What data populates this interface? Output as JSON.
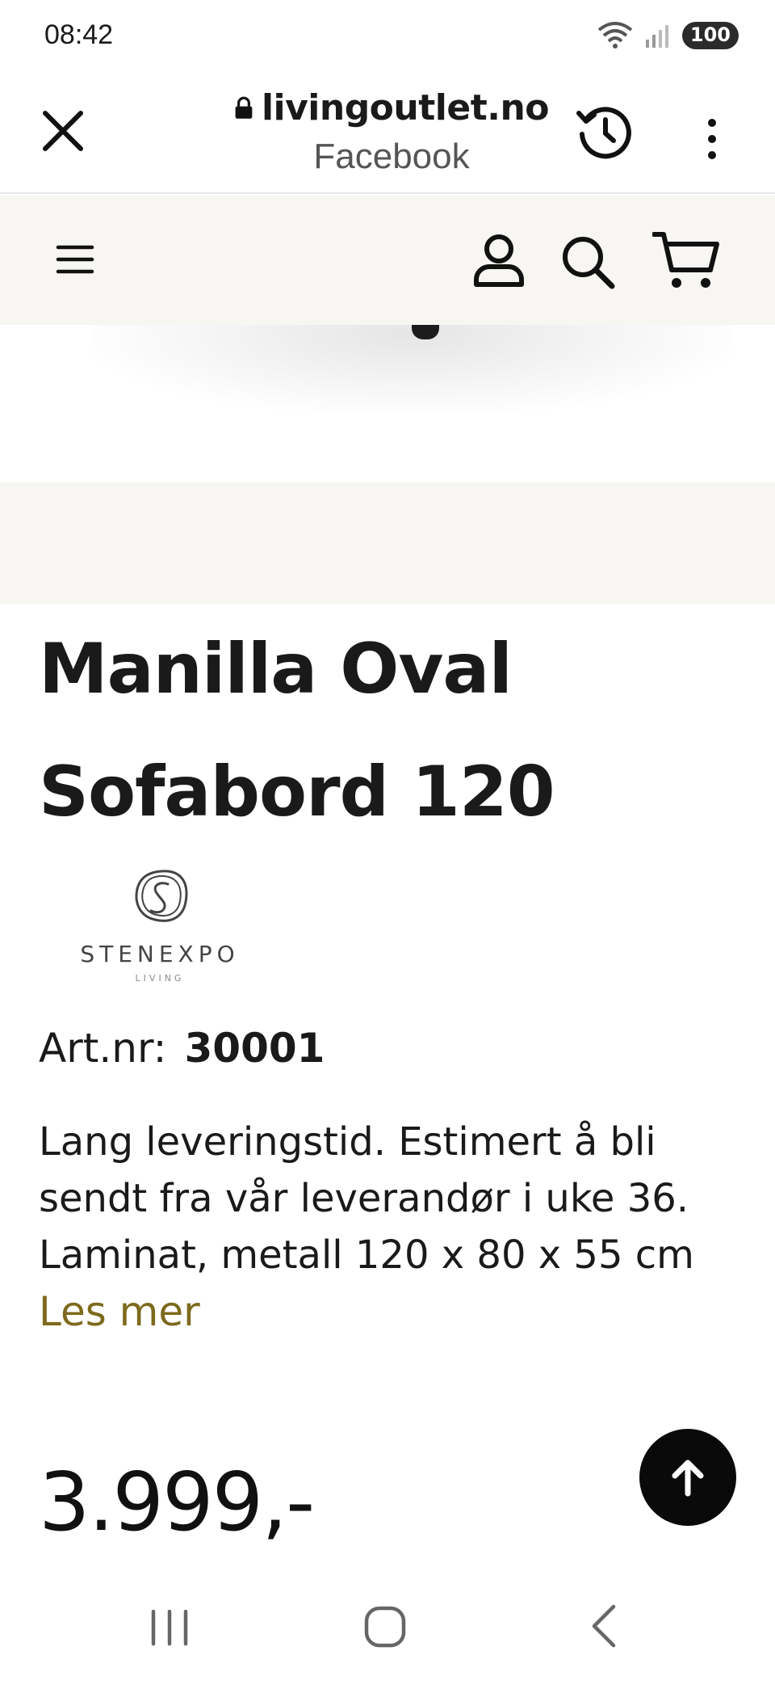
{
  "status_bar": {
    "time": "08:42",
    "battery": "100",
    "icons": [
      "wifi-icon",
      "signal-icon",
      "battery-icon"
    ]
  },
  "browser": {
    "domain": "livingoutlet.no",
    "subtitle": "Facebook",
    "icons": [
      "close-icon",
      "lock-icon",
      "history-icon",
      "more-vert-icon"
    ]
  },
  "site_header": {
    "icons": [
      "hamburger-menu-icon",
      "account-icon",
      "search-icon",
      "cart-icon"
    ]
  },
  "product": {
    "title_line1": "Manilla Oval",
    "title_line2": "Sofabord 120",
    "brand_name": "STENEXPO",
    "brand_tagline": "LIVING",
    "artnr_label": "Art.nr:",
    "artnr_value": "30001",
    "description": "Lang leveringstid. Estimert å bli\nsendt fra vår leverandør i uke 36.\nLaminat, metall  120 x 80 x 55 cm",
    "read_more": "Les mer",
    "price": "3.999,-"
  },
  "colors": {
    "header_bg": "#f7f6f2",
    "accent_link": "#7d6a1d",
    "scroll_button": "#0a0a0a"
  }
}
